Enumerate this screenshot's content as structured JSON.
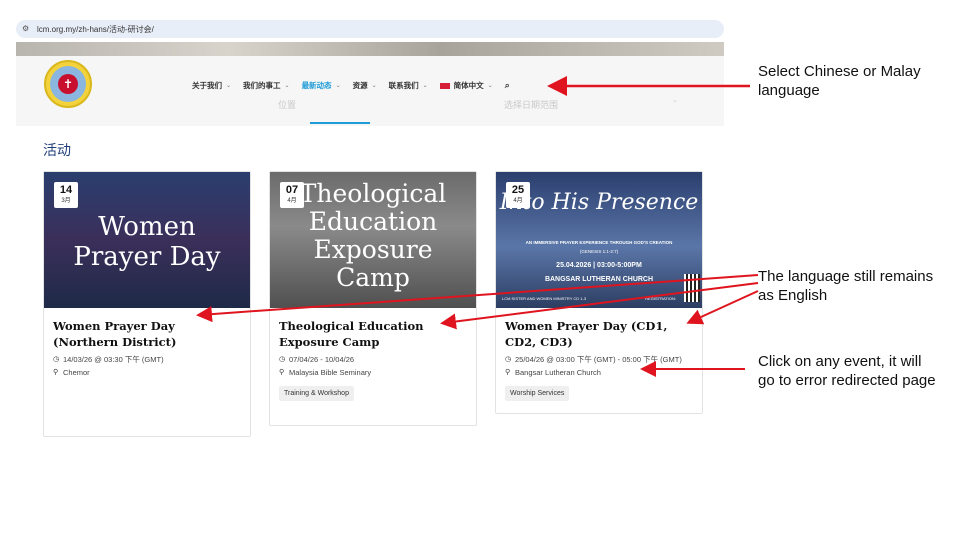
{
  "browser": {
    "url": "lcm.org.my/zh-hans/活动-研讨会/"
  },
  "nav": {
    "items": [
      {
        "label": "关于我们",
        "has_dropdown": true,
        "active": false
      },
      {
        "label": "我们的事工",
        "has_dropdown": true,
        "active": false
      },
      {
        "label": "最新动态",
        "has_dropdown": true,
        "active": true
      },
      {
        "label": "资源",
        "has_dropdown": true,
        "active": false
      },
      {
        "label": "联系我们",
        "has_dropdown": true,
        "active": false
      }
    ],
    "language": "简体中文",
    "ghost_location": "位置",
    "ghost_date": "选择日期范围"
  },
  "section_title": "活动",
  "events": [
    {
      "day": "14",
      "month": "3月",
      "image_text": "Women Prayer Day",
      "title": "Women Prayer Day (Northern District)",
      "datetime": "14/03/26 @ 03:30 下午 (GMT)",
      "location": "Chemor",
      "tag": ""
    },
    {
      "day": "07",
      "month": "4月",
      "image_text": "Theological Education Exposure Camp",
      "title": "Theological Education Exposure Camp",
      "datetime": "07/04/26 - 10/04/26",
      "location": "Malaysia Bible Seminary",
      "tag": "Training & Workshop"
    },
    {
      "day": "25",
      "month": "4月",
      "image_text": "Into His Presence",
      "image_sub1": "AN IMMERSIVE PRAYER EXPERIENCE THROUGH GOD'S CREATION",
      "image_sub2": "(GENESIS 1:1-2:7)",
      "image_sub3": "25.04.2026 | 03:00-5:00PM",
      "image_sub4": "BANGSAR LUTHERAN CHURCH",
      "image_sub5": "LCM SISTER AND WOMEN MINISTRY CD 1-3",
      "image_sub6": "REGISTRATION:",
      "title": "Women Prayer Day (CD1, CD2, CD3)",
      "datetime": "25/04/26 @ 03:00 下午 (GMT) - 05:00 下午 (GMT)",
      "location": "Bangsar Lutheran Church",
      "tag": "Worship Services"
    }
  ],
  "annotations": {
    "a1": "Select Chinese or Malay language",
    "a2": "The language still remains as English",
    "a3": "Click on any event, it will go to error redirected page"
  },
  "colors": {
    "accent": "#1c9bd6",
    "title_blue": "#1f3f7a",
    "arrow_red": "#e0141e"
  }
}
